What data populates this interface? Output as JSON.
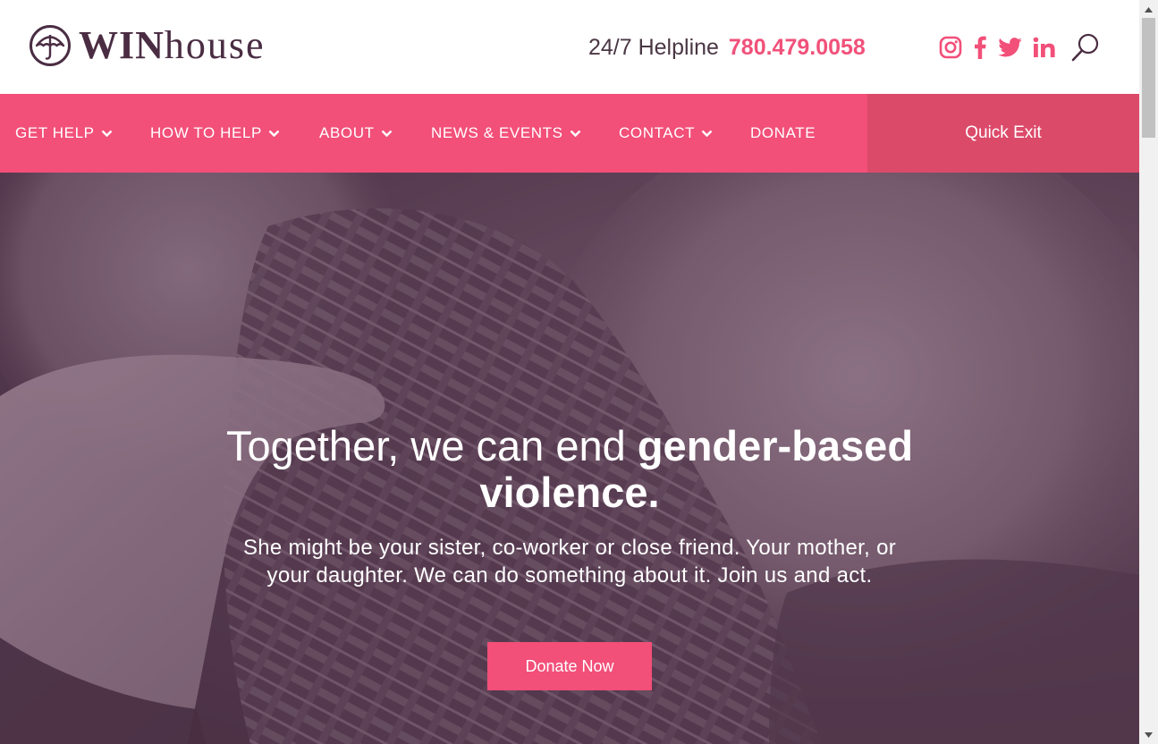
{
  "header": {
    "logo_primary": "WIN",
    "logo_secondary": "house",
    "logo_icon": "umbrella-icon",
    "helpline_label": "24/7 Helpline",
    "helpline_phone": "780.479.0058",
    "social": [
      {
        "name": "instagram-icon"
      },
      {
        "name": "facebook-icon"
      },
      {
        "name": "twitter-icon"
      },
      {
        "name": "linkedin-icon"
      }
    ],
    "search_icon": "search-icon"
  },
  "nav": {
    "items": [
      {
        "label": "GET HELP",
        "has_dropdown": true
      },
      {
        "label": "HOW TO HELP",
        "has_dropdown": true
      },
      {
        "label": "ABOUT",
        "has_dropdown": true
      },
      {
        "label": "NEWS & EVENTS",
        "has_dropdown": true
      },
      {
        "label": "CONTACT",
        "has_dropdown": true
      },
      {
        "label": "DONATE",
        "has_dropdown": false
      }
    ],
    "quick_exit": "Quick Exit"
  },
  "hero": {
    "title_light": "Together, we can end ",
    "title_bold": "gender-based violence.",
    "subtitle": "She might be your sister, co-worker or close friend. Your mother, or your daughter. We can do something about it. Join us and act.",
    "cta": "Donate Now"
  },
  "colors": {
    "brand_pink": "#f24f79",
    "quick_exit_bg": "#dc4a6a",
    "brand_plum": "#4a2d43",
    "hero_overlay": "#5b4055"
  }
}
